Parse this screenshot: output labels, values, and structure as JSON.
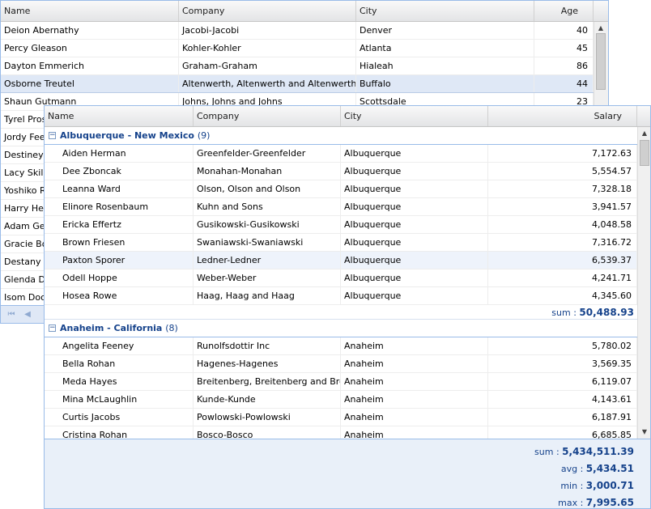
{
  "back_grid": {
    "columns": [
      "Name",
      "Company",
      "City",
      "Age"
    ],
    "rows": [
      [
        "Deion Abernathy",
        "Jacobi-Jacobi",
        "Denver",
        "40"
      ],
      [
        "Percy Gleason",
        "Kohler-Kohler",
        "Atlanta",
        "45"
      ],
      [
        "Dayton Emmerich",
        "Graham-Graham",
        "Hialeah",
        "86"
      ],
      [
        "Osborne Treutel",
        "Altenwerth, Altenwerth and Altenwerth",
        "Buffalo",
        "44"
      ],
      [
        "Shaun Gutmann",
        "Johns, Johns and Johns",
        "Scottsdale",
        "23"
      ],
      [
        "Tyrel Pros",
        "",
        "",
        ""
      ],
      [
        "Jordy Feen",
        "",
        "",
        ""
      ],
      [
        "Destiney B",
        "",
        "",
        ""
      ],
      [
        "Lacy Skiles",
        "",
        "",
        ""
      ],
      [
        "Yoshiko Ri",
        "",
        "",
        ""
      ],
      [
        "Harry Hea",
        "",
        "",
        ""
      ],
      [
        "Adam Gerl",
        "",
        "",
        ""
      ],
      [
        "Gracie Bog",
        "",
        "",
        ""
      ],
      [
        "Destany W",
        "",
        "",
        ""
      ],
      [
        "Glenda Da",
        "",
        "",
        ""
      ],
      [
        "Isom Doole",
        "",
        "",
        ""
      ]
    ],
    "selected_row": 3
  },
  "front_grid": {
    "columns": [
      "Name",
      "Company",
      "City",
      "Salary"
    ],
    "groups": [
      {
        "title": "Albuquerque - New Mexico",
        "count": "(9)",
        "rows": [
          [
            "Aiden Herman",
            "Greenfelder-Greenfelder",
            "Albuquerque",
            "7,172.63"
          ],
          [
            "Dee Zboncak",
            "Monahan-Monahan",
            "Albuquerque",
            "5,554.57"
          ],
          [
            "Leanna Ward",
            "Olson, Olson and Olson",
            "Albuquerque",
            "7,328.18"
          ],
          [
            "Elinore Rosenbaum",
            "Kuhn and Sons",
            "Albuquerque",
            "3,941.57"
          ],
          [
            "Ericka Effertz",
            "Gusikowski-Gusikowski",
            "Albuquerque",
            "4,048.58"
          ],
          [
            "Brown Friesen",
            "Swaniawski-Swaniawski",
            "Albuquerque",
            "7,316.72"
          ],
          [
            "Paxton Sporer",
            "Ledner-Ledner",
            "Albuquerque",
            "6,539.37"
          ],
          [
            "Odell Hoppe",
            "Weber-Weber",
            "Albuquerque",
            "4,241.71"
          ],
          [
            "Hosea Rowe",
            "Haag, Haag and Haag",
            "Albuquerque",
            "4,345.60"
          ]
        ],
        "sum_label": "sum :",
        "sum_value": "50,488.93"
      },
      {
        "title": "Anaheim - California",
        "count": "(8)",
        "rows": [
          [
            "Angelita Feeney",
            "Runolfsdottir Inc",
            "Anaheim",
            "5,780.02"
          ],
          [
            "Bella Rohan",
            "Hagenes-Hagenes",
            "Anaheim",
            "3,569.35"
          ],
          [
            "Meda Hayes",
            "Breitenberg, Breitenberg and Breiter",
            "Anaheim",
            "6,119.07"
          ],
          [
            "Mina McLaughlin",
            "Kunde-Kunde",
            "Anaheim",
            "4,143.61"
          ],
          [
            "Curtis Jacobs",
            "Powlowski-Powlowski",
            "Anaheim",
            "6,187.91"
          ],
          [
            "Cristina Rohan",
            "Bosco-Bosco",
            "Anaheim",
            "6,685.85"
          ]
        ]
      }
    ],
    "hover_row": "0.6",
    "summary": [
      {
        "label": "sum :",
        "value": "5,434,511.39"
      },
      {
        "label": "avg :",
        "value": "5,434.51"
      },
      {
        "label": "min :",
        "value": "3,000.71"
      },
      {
        "label": "max :",
        "value": "7,995.65"
      }
    ]
  },
  "icons": {
    "group_toggle": "collapse-icon",
    "scroll_up": "scroll-up-icon",
    "scroll_down": "scroll-down-icon",
    "pager_first": "first-page-icon",
    "pager_prev": "prev-page-icon"
  },
  "colors": {
    "header_border": "#99bbe8",
    "group_text": "#15428b",
    "selected_row": "#dfe8f6"
  }
}
